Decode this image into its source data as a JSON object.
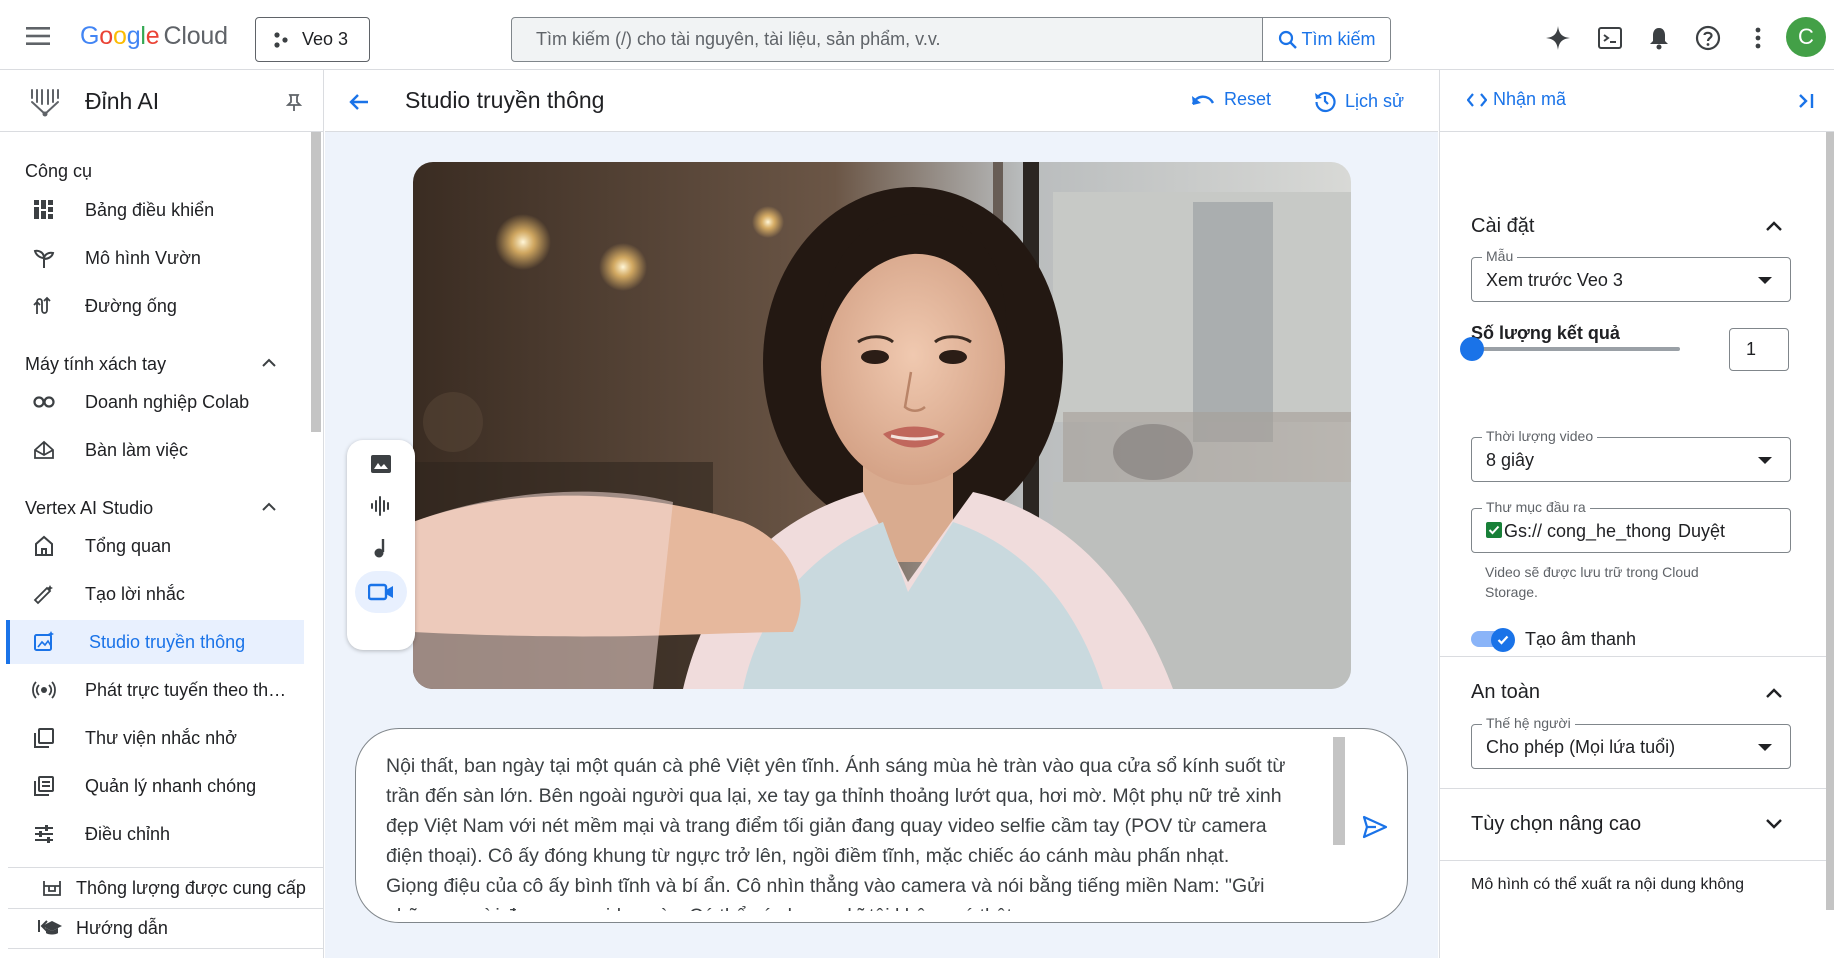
{
  "topbar": {
    "logo_google": "Google",
    "logo_cloud": "Cloud",
    "project": "Veo 3",
    "search_placeholder": "Tìm kiếm (/) cho tài nguyên, tài liệu, sản phẩm, v.v.",
    "search_button": "Tìm kiếm",
    "avatar_letter": "C",
    "avatar_color": "#43a047"
  },
  "leftnav": {
    "title": "Đỉnh AI",
    "sections": {
      "tools": "Công cụ",
      "notebooks": "Máy tính xách tay",
      "studio": "Vertex AI Studio"
    },
    "items": [
      {
        "label": "Bảng điều khiển",
        "icon": "dashboard-icon"
      },
      {
        "label": "Mô hình Vườn",
        "icon": "model-garden-icon"
      },
      {
        "label": "Đường ống",
        "icon": "pipelines-icon"
      },
      {
        "label": "Doanh nghiệp Colab",
        "icon": "colab-icon"
      },
      {
        "label": "Bàn làm việc",
        "icon": "workbench-icon"
      },
      {
        "label": "Tổng quan",
        "icon": "home-icon"
      },
      {
        "label": "Tạo lời nhắc",
        "icon": "magic-pen-icon"
      },
      {
        "label": "Studio truyền thông",
        "icon": "media-studio-icon"
      },
      {
        "label": "Phát trực tuyến theo thời gian thực",
        "icon": "streaming-icon"
      },
      {
        "label": "Thư viện nhắc nhở",
        "icon": "prompt-gallery-icon"
      },
      {
        "label": "Quản lý nhanh chóng",
        "icon": "prompt-management-icon"
      },
      {
        "label": "Điều chỉnh",
        "icon": "tune-icon"
      }
    ],
    "bottom": [
      {
        "label": "Thông lượng được cung cấp",
        "icon": "throughput-icon"
      },
      {
        "label": "Hướng dẫn",
        "icon": "school-icon"
      }
    ]
  },
  "center": {
    "title": "Studio truyền thông",
    "reset": "Reset",
    "history": "Lịch sử",
    "prompt_text": "Nội thất, ban ngày tại một quán cà phê Việt yên tĩnh. Ánh sáng mùa hè tràn vào qua cửa sổ kính suốt từ trần đến sàn lớn. Bên ngoài người qua lại, xe tay ga thỉnh thoảng lướt qua, hơi mờ. Một phụ nữ trẻ xinh đẹp Việt Nam với nét mềm mại và trang điểm tối giản đang quay video selfie cầm tay (POV từ camera điện thoại). Cô ấy đóng khung từ ngực trở lên, ngồi điềm tĩnh, mặc chiếc áo cánh màu phấn nhạt. Giọng điệu của cô ấy bình tĩnh và bí ẩn. Cô nhìn thẳng vào camera và nói bằng tiếng miền Nam: \"Gửi những người đang xem video này. Có thể các bạn nghĩ tôi không có thật"
  },
  "right": {
    "get_code": "Nhận mã",
    "settings_title": "Cài đặt",
    "model_label": "Mẫu",
    "model_value": "Xem trước Veo 3",
    "results_label": "Số lượng kết quả",
    "results_value": "1",
    "results_slider_fraction": 0,
    "duration_label": "Thời lượng video",
    "duration_value": "8 giây",
    "output_label": "Thư mục đầu ra",
    "output_value": "Gs:// cong_he_thong",
    "browse": "Duyệt",
    "output_helper": "Video sẽ được lưu trữ trong Cloud Storage.",
    "audio_label": "Tạo âm thanh",
    "audio_enabled": true,
    "safety_title": "An toàn",
    "person_label": "Thế hệ người",
    "person_value": "Cho phép (Mọi lứa tuổi)",
    "advanced_title": "Tùy chọn nâng cao",
    "cut_text": "Mô hình có thể xuất ra nội dung không"
  },
  "colors": {
    "accent": "#1a73e8",
    "active_bg": "#e8f0fe",
    "canvas_bg": "#eef3fb"
  }
}
